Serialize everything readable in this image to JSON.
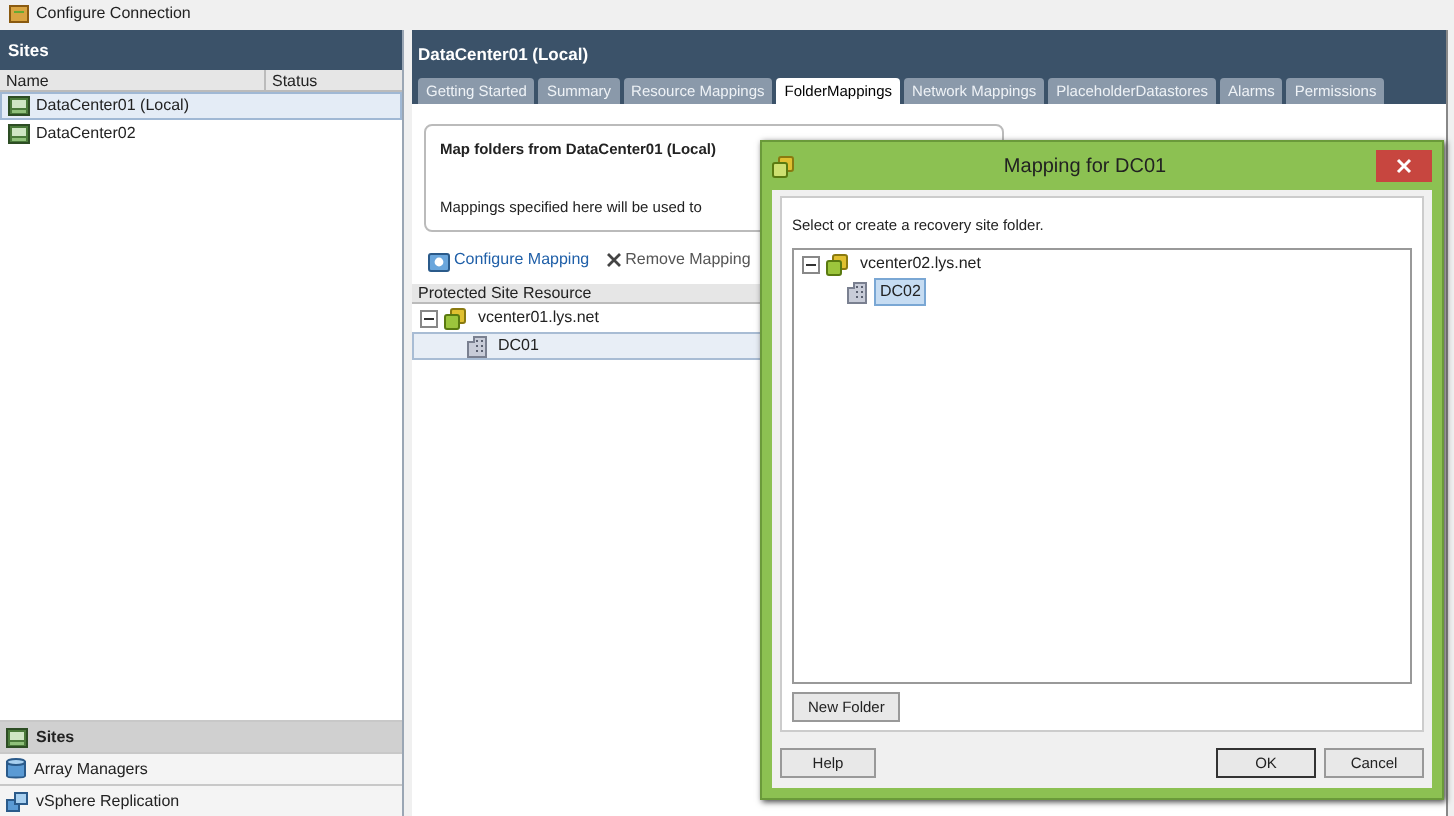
{
  "toolbar": {
    "items": [
      {
        "label": "Configure Connection"
      }
    ]
  },
  "sites_panel": {
    "title": "Sites",
    "columns": [
      "Name",
      "Status"
    ],
    "rows": [
      {
        "name": "DataCenter01 (Local)",
        "selected": true
      },
      {
        "name": "DataCenter02",
        "selected": false
      }
    ]
  },
  "nav": [
    {
      "label": "Sites",
      "selected": true,
      "kind": "sites"
    },
    {
      "label": "Array Managers",
      "selected": false,
      "kind": "array"
    },
    {
      "label": "vSphere Replication",
      "selected": false,
      "kind": "replication"
    }
  ],
  "main": {
    "title": "DataCenter01 (Local)",
    "tabs": [
      {
        "label": "Getting Started",
        "selected": false
      },
      {
        "label": "Summary",
        "selected": false
      },
      {
        "label": "Resource Mappings",
        "selected": false
      },
      {
        "label": "FolderMappings",
        "selected": true
      },
      {
        "label": "Network Mappings",
        "selected": false
      },
      {
        "label": "PlaceholderDatastores",
        "selected": false
      },
      {
        "label": "Alarms",
        "selected": false
      },
      {
        "label": "Permissions",
        "selected": false
      }
    ],
    "info_box": {
      "heading": "Map folders from DataCenter01 (Local)",
      "text": "Mappings specified here will be used to"
    },
    "actions": [
      {
        "label": "Configure Mapping",
        "kind": "configure",
        "disabled": false
      },
      {
        "label": "Remove Mapping",
        "kind": "remove",
        "disabled": true
      }
    ],
    "tree": {
      "column": "Protected Site Resource",
      "nodes": [
        {
          "label": "vcenter01.lys.net",
          "kind": "vcenter",
          "expanded": true,
          "selected": false,
          "children": [
            {
              "label": "DC01",
              "kind": "datacenter",
              "selected": true
            }
          ]
        }
      ]
    }
  },
  "dialog": {
    "title": "Mapping for DC01",
    "instruction": "Select or create a recovery site folder.",
    "tree": [
      {
        "label": "vcenter02.lys.net",
        "kind": "vcenter",
        "expanded": true,
        "selected": false,
        "children": [
          {
            "label": "DC02",
            "kind": "datacenter",
            "selected": true
          }
        ]
      }
    ],
    "new_folder_button": "New Folder",
    "left_buttons": [
      "Help"
    ],
    "right_buttons": [
      "OK",
      "Cancel"
    ]
  }
}
